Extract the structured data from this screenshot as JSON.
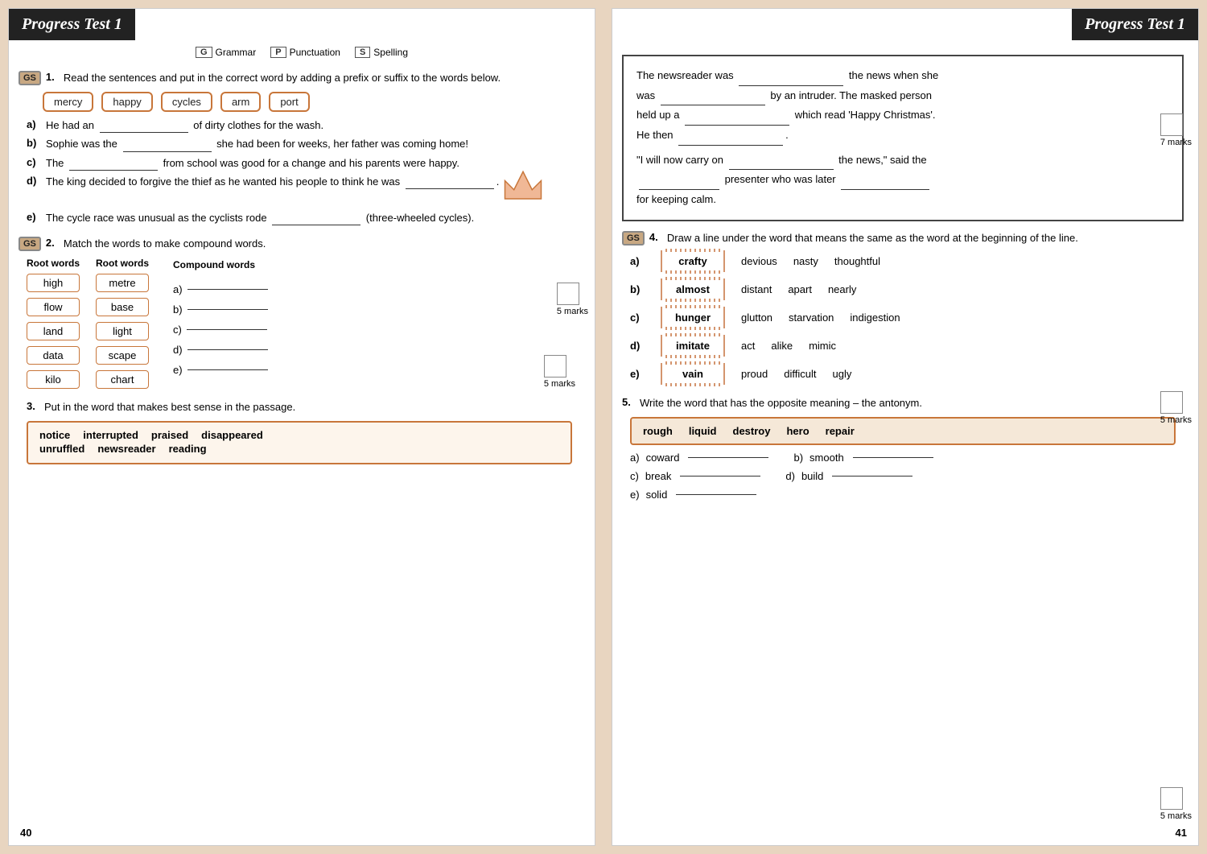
{
  "left": {
    "title": "Progress Test 1",
    "page_num": "40",
    "legend": [
      {
        "code": "G",
        "label": "Grammar"
      },
      {
        "code": "P",
        "label": "Punctuation"
      },
      {
        "code": "S",
        "label": "Spelling"
      }
    ],
    "q1": {
      "badge": "GS",
      "num": "1.",
      "text": "Read the sentences and put in the correct word by adding a prefix or suffix to the words below.",
      "words": [
        "mercy",
        "happy",
        "cycles",
        "arm",
        "port"
      ],
      "subs": [
        {
          "letter": "a)",
          "text": "He had an",
          "blank": true,
          "after": "of dirty clothes for the wash."
        },
        {
          "letter": "b)",
          "text": "Sophie was the",
          "blank": true,
          "after": "she had been for weeks, her father was coming home!"
        },
        {
          "letter": "c)",
          "text": "The",
          "blank": true,
          "after": "from school was good for a change and his parents were happy."
        },
        {
          "letter": "d)",
          "text": "The king decided to forgive the thief as he wanted his people to think he was",
          "blank": true,
          "after": "."
        },
        {
          "letter": "e)",
          "text": "The cycle race was unusual as the cyclists rode",
          "blank": true,
          "after": "(three-wheeled cycles)."
        }
      ],
      "marks": "5 marks"
    },
    "q2": {
      "badge": "GS",
      "num": "2.",
      "text": "Match the words to make compound words.",
      "col1_header": "Root words",
      "col2_header": "Root words",
      "col3_header": "Compound words",
      "col1": [
        "high",
        "flow",
        "land",
        "data",
        "kilo"
      ],
      "col2": [
        "metre",
        "base",
        "light",
        "scape",
        "chart"
      ],
      "subs": [
        "a)",
        "b)",
        "c)",
        "d)",
        "e)"
      ],
      "marks": "5 marks"
    },
    "q3": {
      "num": "3.",
      "text": "Put in the word that makes best sense in the passage.",
      "words_row1": [
        "notice",
        "interrupted",
        "praised",
        "disappeared"
      ],
      "words_row2": [
        "unruffled",
        "newsreader",
        "reading"
      ]
    }
  },
  "right": {
    "title": "Progress Test 1",
    "page_num": "41",
    "passage": {
      "lines": [
        "The newsreader was ________________ the news when she",
        "was ________________ by an intruder. The masked person",
        "held up a ________________ which read 'Happy Christmas'.",
        "He then ________________.",
        "",
        "\"I will now carry on ________________ the news,\" said the",
        "________________ presenter who was later ________________",
        "for keeping calm."
      ],
      "marks": "7 marks"
    },
    "q4": {
      "badge": "GS",
      "num": "4.",
      "text": "Draw a line under the word that means the same as the word at the beginning of the line.",
      "subs": [
        {
          "letter": "a)",
          "word": "crafty",
          "options": [
            "devious",
            "nasty",
            "thoughtful"
          ]
        },
        {
          "letter": "b)",
          "word": "almost",
          "options": [
            "distant",
            "apart",
            "nearly"
          ]
        },
        {
          "letter": "c)",
          "word": "hunger",
          "options": [
            "glutton",
            "starvation",
            "indigestion"
          ]
        },
        {
          "letter": "d)",
          "word": "imitate",
          "options": [
            "act",
            "alike",
            "mimic"
          ]
        },
        {
          "letter": "e)",
          "word": "vain",
          "options": [
            "proud",
            "difficult",
            "ugly"
          ]
        }
      ],
      "marks": "5 marks"
    },
    "q5": {
      "num": "5.",
      "text": "Write the word that has the opposite meaning – the antonym.",
      "words": [
        "rough",
        "liquid",
        "destroy",
        "hero",
        "repair"
      ],
      "subs": [
        {
          "letter": "a)",
          "clue": "coward"
        },
        {
          "letter": "b)",
          "clue": "smooth"
        },
        {
          "letter": "c)",
          "clue": "break"
        },
        {
          "letter": "d)",
          "clue": "build"
        },
        {
          "letter": "e)",
          "clue": "solid"
        }
      ],
      "marks": "5 marks"
    }
  }
}
